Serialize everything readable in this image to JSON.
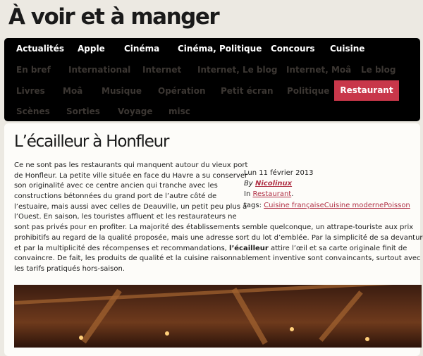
{
  "site": {
    "title": "À voir et à manger"
  },
  "nav": {
    "row1": [
      "Actualités",
      "Apple",
      "Cinéma",
      "Cinéma, Politique",
      "Concours",
      "Cuisine"
    ],
    "row2": [
      "En bref",
      "International",
      "Internet",
      "Internet, Le blog",
      "Internet, Moâ",
      "Le blog"
    ],
    "row3": [
      "Livres",
      "Moâ",
      "Musique",
      "Opération",
      "Petit écran",
      "Politique",
      "Restaurant"
    ],
    "row4": [
      "Scènes",
      "Sorties",
      "Voyage",
      "misc"
    ],
    "active": "Restaurant"
  },
  "post": {
    "title": "L’écailleur à Honfleur",
    "lines": [
      "Ce ne sont pas les restaurants qui manquent autour du vieux port",
      "de Honfleur. La petite ville située en face du Havre a su conserver",
      "son originalité avec ce centre ancien qui tranche avec les",
      "constructions bétonnées du grand port de l’autre côté de",
      "l’estuaire, mais aussi avec celles de Deauville, un petit peu plus à",
      "l’Ouest. En saison, les touristes affluent et les restaurateurs ne",
      "sont pas privés pour en profiter. La majorité des établissements semble quelconque, un attrape-touriste aux prix",
      "prohibitifs au regard de la qualité proposée, mais une adresse sort du lot d’emblée. Par la simplicité de sa devanture",
      "et par la multiplicité des récompenses et recommandations, ",
      "convaincre. De fait, les produits de qualité et la cuisine raisonnablement inventive sont convaincants, surtout avec",
      "les tarifs pratiqués hors-saison."
    ],
    "line9_bold": "l’écailleur",
    "line9_rest": " attire l’œil et sa carte originale finit de",
    "meta": {
      "date": "Lun 11 février 2013",
      "by_prefix": "By ",
      "author": "Nicolinux",
      "in_prefix": "In ",
      "category": "Restaurant",
      "category_suffix": ".",
      "tags_prefix": "tags: ",
      "tags": [
        "Cuisine française",
        "Cuisine moderne",
        "Poisson"
      ]
    }
  },
  "colors": {
    "accent": "#c8374a",
    "link": "#b03045",
    "nav_bg": "#000000",
    "page_bg": "#ece9e2"
  }
}
